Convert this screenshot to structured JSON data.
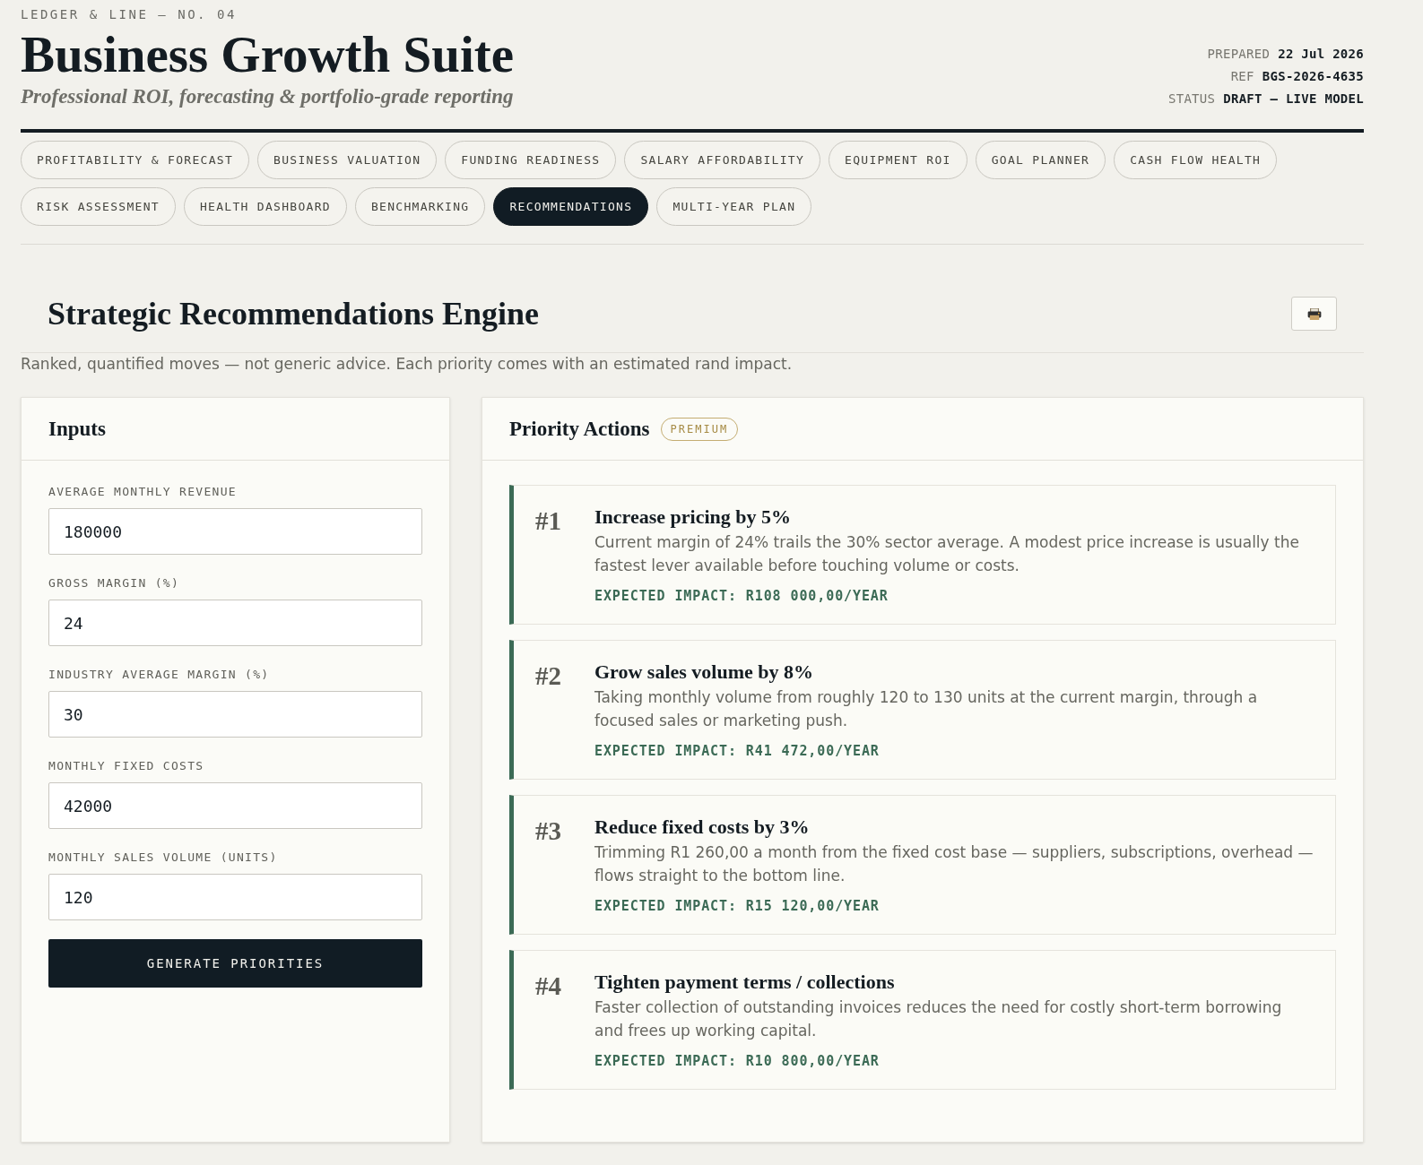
{
  "brand": {
    "kicker": "LEDGER & LINE — NO. 04",
    "title": "Business Growth Suite",
    "subtitle": "Professional ROI, forecasting & portfolio-grade reporting"
  },
  "meta": [
    {
      "label": "PREPARED",
      "value": "22 Jul 2026"
    },
    {
      "label": "REF",
      "value": "BGS-2026-4635"
    },
    {
      "label": "STATUS",
      "value": "DRAFT — LIVE MODEL"
    }
  ],
  "tabs": [
    {
      "label": "PROFITABILITY & FORECAST",
      "selected": false
    },
    {
      "label": "BUSINESS VALUATION",
      "selected": false
    },
    {
      "label": "FUNDING READINESS",
      "selected": false
    },
    {
      "label": "SALARY AFFORDABILITY",
      "selected": false
    },
    {
      "label": "EQUIPMENT ROI",
      "selected": false
    },
    {
      "label": "GOAL PLANNER",
      "selected": false
    },
    {
      "label": "CASH FLOW HEALTH",
      "selected": false
    },
    {
      "label": "RISK ASSESSMENT",
      "selected": false
    },
    {
      "label": "HEALTH DASHBOARD",
      "selected": false
    },
    {
      "label": "BENCHMARKING",
      "selected": false
    },
    {
      "label": "RECOMMENDATIONS",
      "selected": true
    },
    {
      "label": "MULTI-YEAR PLAN",
      "selected": false
    }
  ],
  "section": {
    "title": "Strategic Recommendations Engine",
    "description": "Ranked, quantified moves — not generic advice. Each priority comes with an estimated rand impact."
  },
  "inputs_panel": {
    "title": "Inputs",
    "fields": [
      {
        "label": "AVERAGE MONTHLY REVENUE",
        "value": "180000"
      },
      {
        "label": "GROSS MARGIN (%)",
        "value": "24"
      },
      {
        "label": "INDUSTRY AVERAGE MARGIN (%)",
        "value": "30"
      },
      {
        "label": "MONTHLY FIXED COSTS",
        "value": "42000"
      },
      {
        "label": "MONTHLY SALES VOLUME (UNITS)",
        "value": "120"
      }
    ],
    "button": "GENERATE PRIORITIES"
  },
  "priority_panel": {
    "title": "Priority Actions",
    "badge": "PREMIUM",
    "actions": [
      {
        "rank": "#1",
        "title": "Increase pricing by 5%",
        "description": "Current margin of 24% trails the 30% sector average. A modest price increase is usually the fastest lever available before touching volume or costs.",
        "impact": "EXPECTED IMPACT: R108 000,00/YEAR"
      },
      {
        "rank": "#2",
        "title": "Grow sales volume by 8%",
        "description": "Taking monthly volume from roughly 120 to 130 units at the current margin, through a focused sales or marketing push.",
        "impact": "EXPECTED IMPACT: R41 472,00/YEAR"
      },
      {
        "rank": "#3",
        "title": "Reduce fixed costs by 3%",
        "description": "Trimming R1 260,00 a month from the fixed cost base — suppliers, subscriptions, overhead — flows straight to the bottom line.",
        "impact": "EXPECTED IMPACT: R15 120,00/YEAR"
      },
      {
        "rank": "#4",
        "title": "Tighten payment terms / collections",
        "description": "Faster collection of outstanding invoices reduces the need for costly short-term borrowing and frees up working capital.",
        "impact": "EXPECTED IMPACT: R10 800,00/YEAR"
      }
    ]
  }
}
